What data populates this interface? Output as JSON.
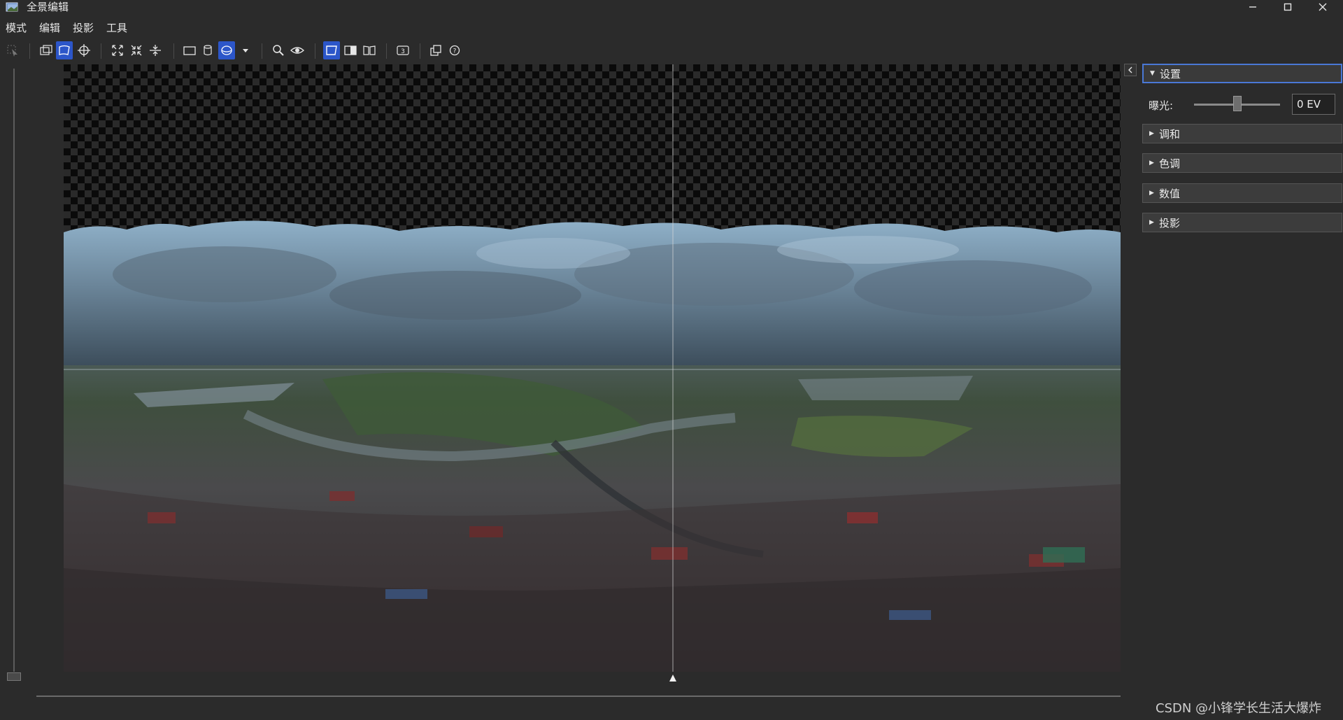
{
  "window": {
    "title": "全景编辑",
    "icons": [
      "app-icon",
      "minimize-icon",
      "maximize-icon",
      "close-icon"
    ]
  },
  "menu": [
    "模式",
    "编辑",
    "投影",
    "工具"
  ],
  "toolbar": {
    "icons": [
      "select-icon",
      "move-frame-icon",
      "edit-frame-icon",
      "crosshair-icon",
      "fit-icon",
      "fit-inner-icon",
      "straighten-icon",
      "rectilinear-icon",
      "cylindrical-icon",
      "spherical-icon",
      "projection-dropdown-icon",
      "zoom-icon",
      "preview-eye-icon",
      "view-normal-icon",
      "view-half-icon",
      "view-split-icon",
      "number-3-icon",
      "layers-icon",
      "help-icon"
    ],
    "active": [
      "edit-frame-icon",
      "spherical-icon",
      "view-normal-icon"
    ]
  },
  "panel": {
    "sections": [
      {
        "label": "设置",
        "open": true
      },
      {
        "label": "调和",
        "open": false
      },
      {
        "label": "色调",
        "open": false
      },
      {
        "label": "数值",
        "open": false
      },
      {
        "label": "投影",
        "open": false
      }
    ],
    "exposure": {
      "label": "曝光:",
      "value": "0 EV",
      "slider_level": 0.5
    }
  },
  "watermark": "CSDN @小锋学长生活大爆炸",
  "colors": {
    "accent": "#2c56c9",
    "focus_border": "#4a78d6",
    "background": "#2b2b2b"
  }
}
